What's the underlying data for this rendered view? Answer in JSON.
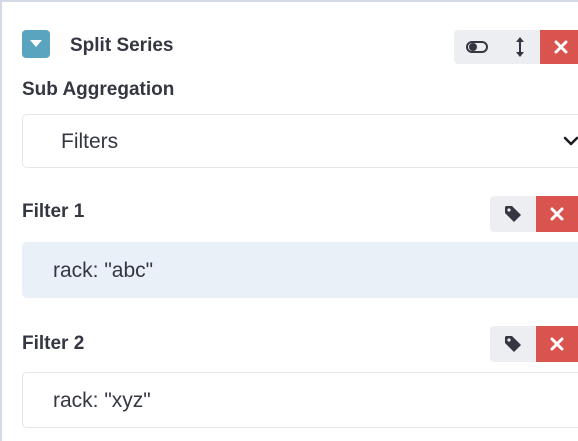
{
  "series": {
    "title": "Split Series",
    "icons": [
      "chevron-down-icon",
      "toggle-icon",
      "drag-vertical-icon",
      "close-icon"
    ]
  },
  "sub_aggregation": {
    "label": "Sub Aggregation",
    "selected": "Filters"
  },
  "filters": [
    {
      "label": "Filter 1",
      "query": "rack: \"abc\""
    },
    {
      "label": "Filter 2",
      "query": "rack: \"xyz\""
    }
  ],
  "colors": {
    "accent": "#5aa4c0",
    "danger": "#d9534f",
    "button_bg": "#eceef2",
    "focus_bg": "#e9f0f8",
    "text": "#343741"
  }
}
